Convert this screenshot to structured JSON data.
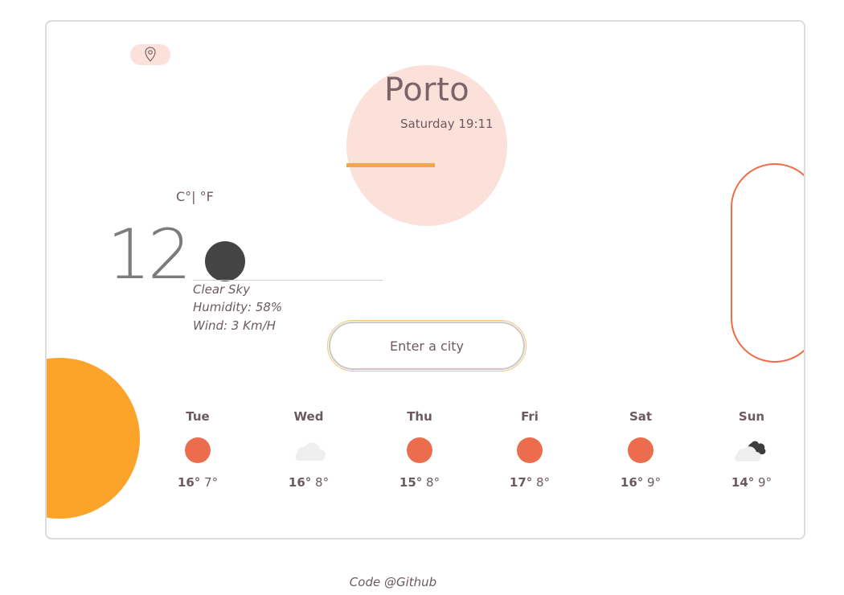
{
  "header": {
    "city": "Porto",
    "date_time": "Saturday 19:11"
  },
  "current": {
    "unit_label": "C°| °F",
    "temperature": "12",
    "condition": "Clear Sky",
    "humidity": "Humidity: 58%",
    "wind": "Wind: 3 Km/H",
    "icon": "moon-icon"
  },
  "search": {
    "placeholder": "Enter a city"
  },
  "forecast": [
    {
      "day": "Tue",
      "max": "16°",
      "min": "7°",
      "icon": "sun-icon"
    },
    {
      "day": "Wed",
      "max": "16°",
      "min": "8°",
      "icon": "cloud-icon"
    },
    {
      "day": "Thu",
      "max": "15°",
      "min": "8°",
      "icon": "sun-icon"
    },
    {
      "day": "Fri",
      "max": "17°",
      "min": "8°",
      "icon": "sun-icon"
    },
    {
      "day": "Sat",
      "max": "16°",
      "min": "9°",
      "icon": "sun-icon"
    },
    {
      "day": "Sun",
      "max": "14°",
      "min": "9°",
      "icon": "cloudy-night-icon"
    }
  ],
  "footer": {
    "text": "Code @Github"
  },
  "colors": {
    "accent_orange": "#fca32a",
    "sun": "#ec6c4e",
    "pink": "#fbe1d9",
    "text": "#6d5a5f"
  }
}
